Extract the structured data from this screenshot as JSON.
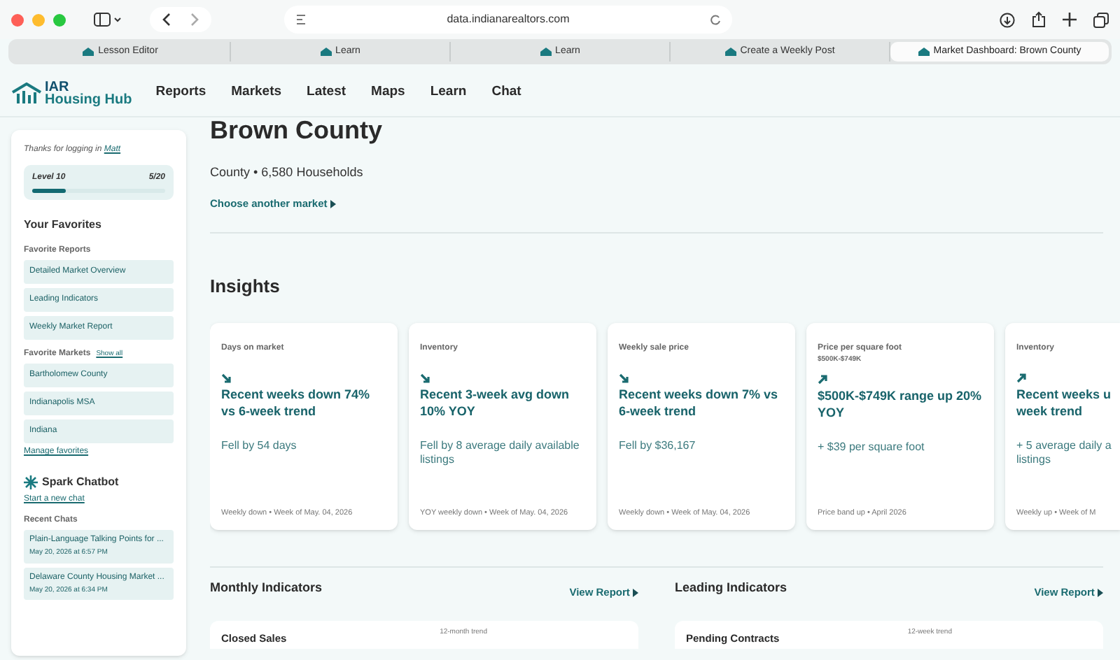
{
  "browser": {
    "address": "data.indianarealtors.com",
    "tabs": [
      {
        "label": "Lesson Editor",
        "selected": false
      },
      {
        "label": "Learn",
        "selected": false
      },
      {
        "label": "Learn",
        "selected": false
      },
      {
        "label": "Create a Weekly Post",
        "selected": false
      },
      {
        "label": "Market Dashboard: Brown County",
        "selected": true
      }
    ]
  },
  "site": {
    "logo_line_1": "IAR",
    "logo_line_2": "Housing Hub",
    "nav": [
      "Reports",
      "Markets",
      "Latest",
      "Maps",
      "Learn",
      "Chat"
    ]
  },
  "sidebar": {
    "greeting": "Thanks for logging in",
    "user": "Matt",
    "level_label": "Level 10",
    "level_count": "5/20",
    "level": 0.25,
    "favorites_title": "Your Favorites",
    "reports_title": "Favorite Reports",
    "reports": [
      "Detailed Market Overview",
      "Leading Indicators",
      "Weekly Market Report"
    ],
    "markets_title": "Favorite Markets",
    "show_all": "Show all",
    "markets": [
      "Bartholomew County",
      "Indianapolis MSA",
      "Indiana"
    ],
    "manage": "Manage favorites",
    "chatbot_title": "Spark Chatbot",
    "new_chat": "Start a new chat",
    "recent_title": "Recent Chats",
    "chats": [
      {
        "title": "Plain-Language Talking Points for ...",
        "time": "May 20, 2026 at 6:57 PM"
      },
      {
        "title": "Delaware County Housing Market ...",
        "time": "May 20, 2026 at 6:34 PM"
      }
    ]
  },
  "market": {
    "title": "Brown County",
    "subtitle": "County • 6,580 Households",
    "change_link": "Choose another market"
  },
  "insights": {
    "title": "Insights",
    "cards": [
      {
        "label": "Days on market",
        "kind": "down",
        "headline": "Recent weeks down 74% vs 6-week trend",
        "detail": "Fell by 54 days",
        "footer": "Weekly down • Week of May. 04, 2026"
      },
      {
        "label": "Inventory",
        "kind": "down",
        "headline": "Recent 3-week avg down 10% YOY",
        "detail": "Fell by 8 average daily available listings",
        "footer": "YOY weekly down • Week of May. 04, 2026"
      },
      {
        "label": "Weekly sale price",
        "kind": "down",
        "headline": "Recent weeks down 7% vs 6-week trend",
        "detail": "Fell by $36,167",
        "footer": "Weekly down • Week of May. 04, 2026"
      },
      {
        "label": "Price per square foot",
        "sublabel": "$500K-$749K",
        "kind": "up",
        "headline": "$500K-$749K range up 20% YOY",
        "detail": "+ $39 per square foot",
        "footer": "Price band up • April 2026"
      },
      {
        "label": "Inventory",
        "kind": "up",
        "headline": "Recent weeks u week trend",
        "detail": "+ 5 average daily a listings",
        "footer": "Weekly up • Week of M"
      }
    ]
  },
  "sections": [
    {
      "title": "Monthly Indicators",
      "link": "View Report",
      "card_title": "Closed Sales",
      "card_note": "12-month trend"
    },
    {
      "title": "Leading Indicators",
      "link": "View Report",
      "card_title": "Pending Contracts",
      "card_note": "12-week trend"
    }
  ]
}
